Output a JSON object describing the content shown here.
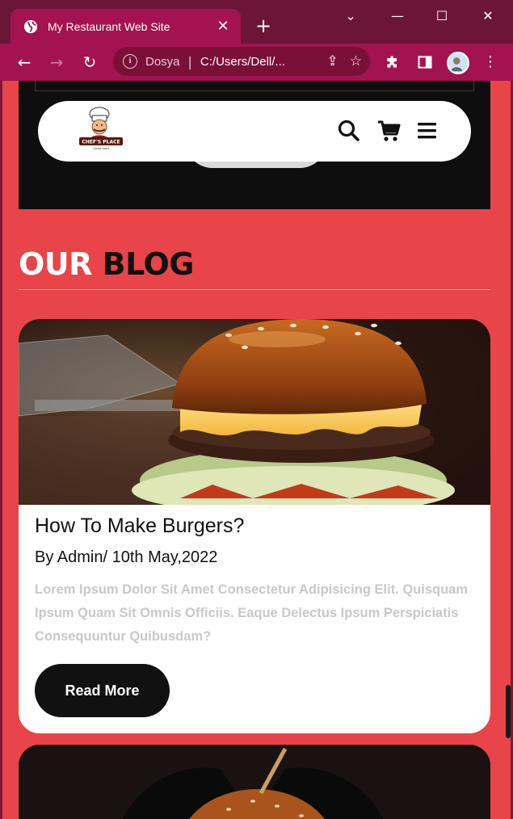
{
  "browser": {
    "tab_title": "My Restaurant Web Site",
    "new_tab_label": "+",
    "close_tab_label": "✕",
    "address": {
      "scheme_label": "Dosya",
      "separator": "|",
      "url": "C:/Users/Dell/..."
    }
  },
  "header": {
    "logo_text": "CHEF'S PLACE",
    "logo_subtext": "Good food",
    "icons": [
      "search-icon",
      "cart-icon",
      "menu-icon"
    ]
  },
  "blog": {
    "title_part1": "OUR",
    "title_part2": "BLOG",
    "post": {
      "title": "How To Make Burgers?",
      "meta": "By Admin/ 10th May,2022",
      "excerpt": "Lorem Ipsum Dolor Sit Amet Consectetur Adipisicing Elit. Quisquam Ipsum Quam Sit Omnis Officiis. Eaque Delectus Ipsum Perspiciatis Consequuntur Quibusdam?",
      "button_label": "Read More"
    }
  },
  "colors": {
    "page_bg": "#e84449",
    "browser_frame": "#a3134f",
    "dark_section": "#0e0e0e"
  }
}
